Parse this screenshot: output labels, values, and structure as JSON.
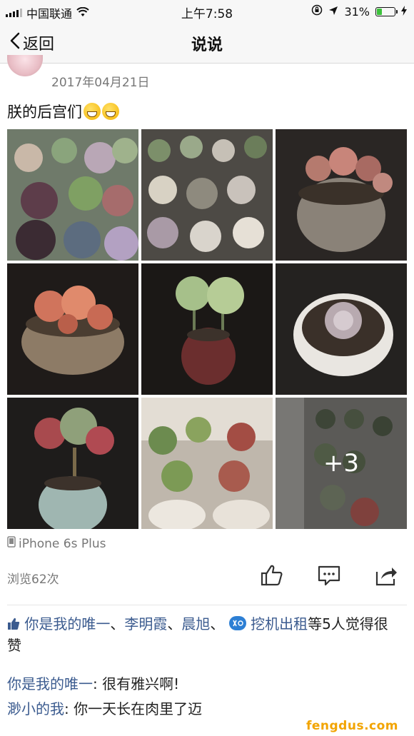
{
  "status_bar": {
    "carrier": "中国联通",
    "time": "上午7:58",
    "battery_percent": "31%",
    "battery_level": 0.31,
    "icons": [
      "signal-icon",
      "wifi-icon",
      "orientation-lock-icon",
      "location-icon",
      "battery-icon",
      "charging-icon"
    ]
  },
  "nav": {
    "back_label": "返回",
    "title": "说说"
  },
  "post": {
    "date": "2017年04月21日",
    "text": "朕的后宫们",
    "photo_count_more": "+3",
    "device": "iPhone 6s Plus",
    "views": "浏览62次"
  },
  "actions": [
    "like-icon",
    "comment-icon",
    "share-icon"
  ],
  "likes": {
    "names": [
      "你是我的唯一",
      "李明霞",
      "晨旭",
      "挖机出租"
    ],
    "separator": "、",
    "suffix_1": "等5人觉得很",
    "suffix_2": "赞"
  },
  "comments": [
    {
      "author": "你是我的唯一",
      "text": ": 很有雅兴啊!"
    },
    {
      "author": "渺小的我",
      "text": ": 你一天长在肉里了迈"
    }
  ],
  "watermark": "fengdus.com",
  "colors": {
    "accent_link": "#3b5b8f",
    "battery_green": "#3cc13b",
    "watermark": "#f2a400"
  }
}
